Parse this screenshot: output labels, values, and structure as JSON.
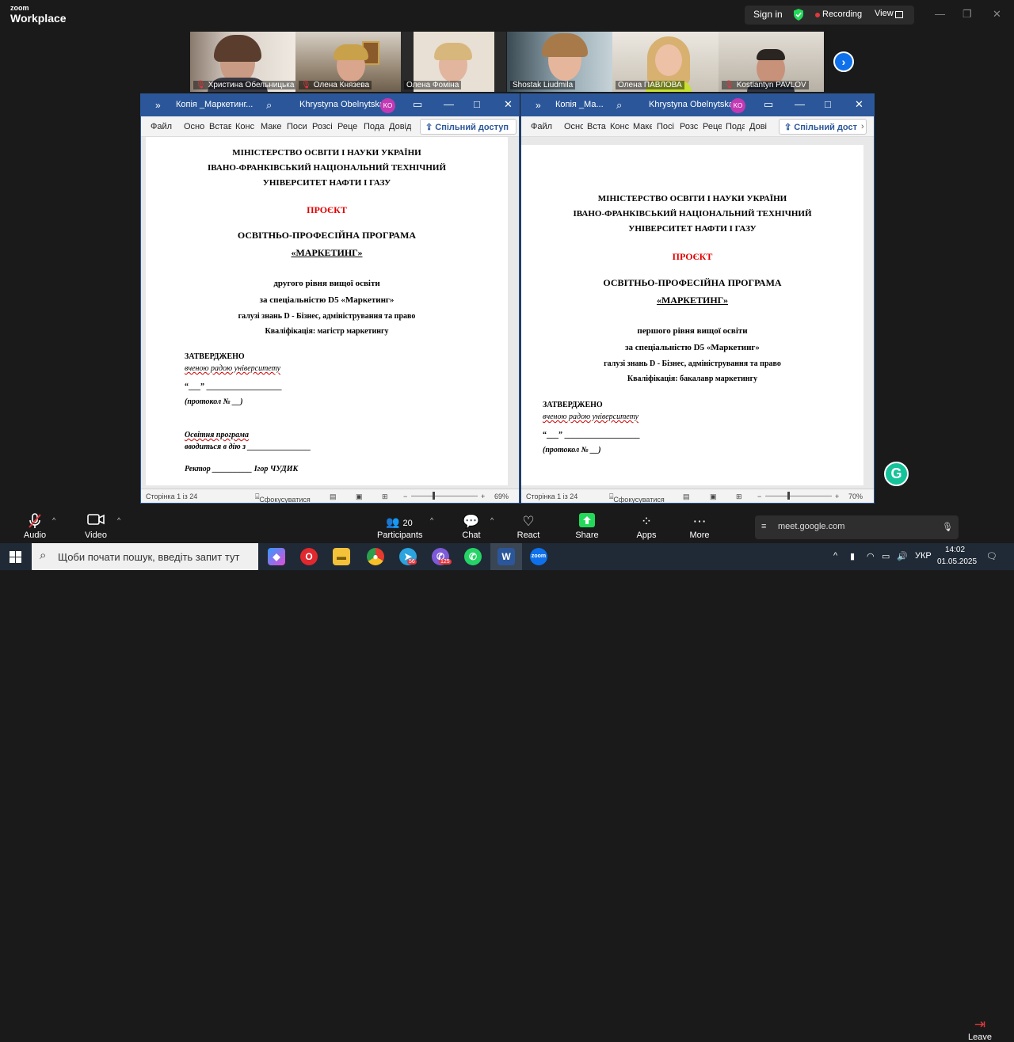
{
  "app": {
    "logo_top": "zoom",
    "logo_bottom": "Workplace"
  },
  "top": {
    "signin": "Sign in",
    "recording": "Recording",
    "view": "View"
  },
  "participants": [
    {
      "name": "Христина Обельницька",
      "muted": true
    },
    {
      "name": "Олена Князева",
      "muted": true
    },
    {
      "name": "Олена Фоміна",
      "muted": false
    },
    {
      "name": "Shostak Liudmila",
      "muted": false
    },
    {
      "name": "Олена ПАВЛОВА",
      "muted": false
    },
    {
      "name": "Kostiantyn PAVLOV",
      "muted": true
    }
  ],
  "word_left": {
    "doc_title": "Копія _Маркетинг...",
    "user": "Khrystyna Obelnytska",
    "initials": "KO",
    "menu": [
      "Файл",
      "Осно",
      "Встав",
      "Конс",
      "Маке",
      "Поси",
      "Розсі",
      "Реце",
      "Пода",
      "Довід"
    ],
    "share": "Спільний доступ",
    "status_page": "Сторінка 1 із 24",
    "status_focus": "Сфокусуватися",
    "zoom": "69%",
    "lines": {
      "l1": "МІНІСТЕРСТВО ОСВІТИ І НАУКИ УКРАЇНИ",
      "l2": "ІВАНО-ФРАНКІВСЬКИЙ НАЦІОНАЛЬНИЙ ТЕХНІЧНИЙ",
      "l3": "УНІВЕРСИТЕТ НАФТИ І ГАЗУ",
      "project": "ПРОЄКТ",
      "prog": "ОСВІТНЬО-ПРОФЕСІЙНА ПРОГРАМА",
      "mkt": "«МАРКЕТИНГ»",
      "level": "другого рівня вищої освіти",
      "spec": "за спеціальністю D5 «Маркетинг»",
      "field": "галузі знань D - Бізнес, адміністрування та право",
      "qual": "Кваліфікація: магістр маркетингу",
      "approved": "ЗАТВЕРДЖЕНО",
      "council": "вченою радою університету",
      "date": "“___” ___________________",
      "protocol": "(протокол № __)",
      "ep": "Освітня програма",
      "intro": "вводиться в дію з ________________",
      "rector": "Ректор __________ Ігор ЧУДИК"
    }
  },
  "word_right": {
    "doc_title": "Копія _Ма...",
    "user": "Khrystyna Obelnytska",
    "initials": "KO",
    "menu": [
      "Файл",
      "Осно",
      "Вста",
      "Конс",
      "Маке",
      "Посі",
      "Розс",
      "Реце",
      "Пода",
      "Дові"
    ],
    "share": "Спільний дост",
    "status_page": "Сторінка 1 із 24",
    "status_focus": "Сфокусуватися",
    "zoom": "70%",
    "lines": {
      "l1": "МІНІСТЕРСТВО ОСВІТИ І НАУКИ УКРАЇНИ",
      "l2": "ІВАНО-ФРАНКІВСЬКИЙ НАЦІОНАЛЬНИЙ ТЕХНІЧНИЙ",
      "l3": "УНІВЕРСИТЕТ НАФТИ І ГАЗУ",
      "project": "ПРОЄКТ",
      "prog": "ОСВІТНЬО-ПРОФЕСІЙНА ПРОГРАМА",
      "mkt": "«МАРКЕТИНГ»",
      "level": "першого рівня вищої освіти",
      "spec": "за спеціальністю D5 «Маркетинг»",
      "field": "галузі знань D - Бізнес, адміністрування та право",
      "qual": "Кваліфікація: бакалавр маркетингу",
      "approved": "ЗАТВЕРДЖЕНО",
      "council": "вченою радою університету",
      "date": "“___” ___________________",
      "protocol": "(протокол № __)"
    }
  },
  "toolbar": {
    "audio": "Audio",
    "video": "Video",
    "participants": "Participants",
    "participants_count": "20",
    "chat": "Chat",
    "react": "React",
    "share": "Share",
    "apps": "Apps",
    "more": "More",
    "meet_url": "meet.google.com",
    "leave": "Leave"
  },
  "taskbar": {
    "search_placeholder": "Щоби почати пошук, введіть запит тут",
    "lang": "УКР",
    "time": "14:02",
    "date": "01.05.2025",
    "badge_telegram": "56",
    "badge_viber": "125"
  },
  "colors": {
    "word_blue": "#2b579a",
    "zoom_blue": "#0e71eb",
    "share_green": "#23d959",
    "leave_red": "#e0383e"
  }
}
